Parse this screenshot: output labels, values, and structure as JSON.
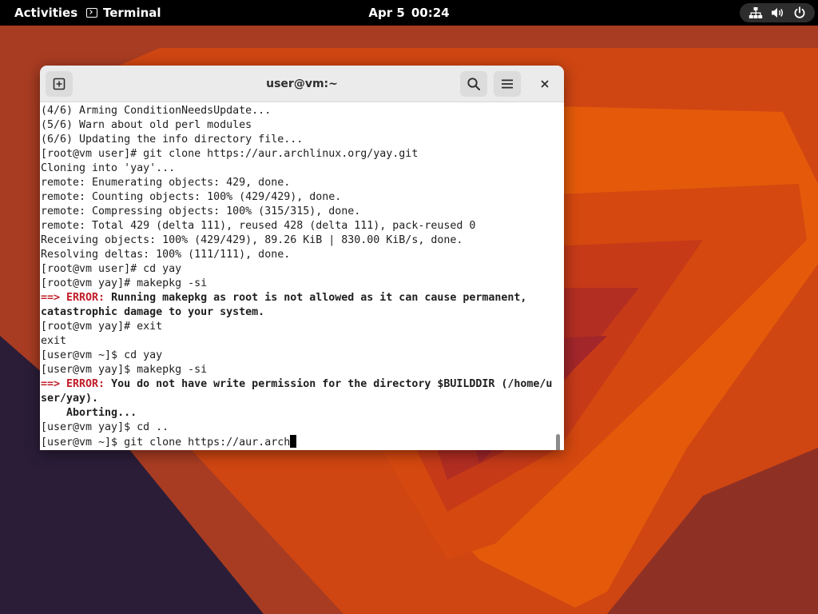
{
  "topbar": {
    "activities_label": "Activities",
    "app_name": "Terminal",
    "date": "Apr 5",
    "time": "00:24",
    "status_icons": [
      "network-wired-icon",
      "volume-icon",
      "power-icon"
    ]
  },
  "window": {
    "title": "user@vm:~",
    "buttons": {
      "new_tab_icon": "new-tab-icon",
      "search_icon": "search-icon",
      "menu_icon": "hamburger-menu-icon",
      "close_icon": "close-icon"
    }
  },
  "terminal": {
    "lines": [
      {
        "text": "(4/6) Arming ConditionNeedsUpdate..."
      },
      {
        "text": "(5/6) Warn about old perl modules"
      },
      {
        "text": "(6/6) Updating the info directory file..."
      },
      {
        "text": "[root@vm user]# git clone https://aur.archlinux.org/yay.git"
      },
      {
        "text": "Cloning into 'yay'..."
      },
      {
        "text": "remote: Enumerating objects: 429, done."
      },
      {
        "text": "remote: Counting objects: 100% (429/429), done."
      },
      {
        "text": "remote: Compressing objects: 100% (315/315), done."
      },
      {
        "text": "remote: Total 429 (delta 111), reused 428 (delta 111), pack-reused 0"
      },
      {
        "text": "Receiving objects: 100% (429/429), 89.26 KiB | 830.00 KiB/s, done."
      },
      {
        "text": "Resolving deltas: 100% (111/111), done."
      },
      {
        "text": "[root@vm user]# cd yay"
      },
      {
        "text": "[root@vm yay]# makepkg -si"
      },
      {
        "prefix": "==> ERROR:",
        "text": " Running makepkg as root is not allowed as it can cause permanent,",
        "bold": true
      },
      {
        "text": "catastrophic damage to your system.",
        "bold": true
      },
      {
        "text": "[root@vm yay]# exit"
      },
      {
        "text": "exit"
      },
      {
        "text": "[user@vm ~]$ cd yay"
      },
      {
        "text": "[user@vm yay]$ makepkg -si"
      },
      {
        "prefix": "==> ERROR:",
        "text": " You do not have write permission for the directory $BUILDDIR (/home/u",
        "bold": true
      },
      {
        "text": "ser/yay).",
        "bold": true
      },
      {
        "text": "    Aborting...",
        "bold": true
      },
      {
        "text": "[user@vm yay]$ cd .."
      },
      {
        "text": "[user@vm ~]$ git clone https://aur.arch",
        "cursor": true
      }
    ]
  },
  "colors": {
    "error_prefix": "#c01c28",
    "topbar_bg": "#000000",
    "wallpaper_orange": "#e55a0a",
    "wallpaper_dark": "#2b1d38"
  },
  "scrollbar": {
    "position_fraction": 1.0
  }
}
